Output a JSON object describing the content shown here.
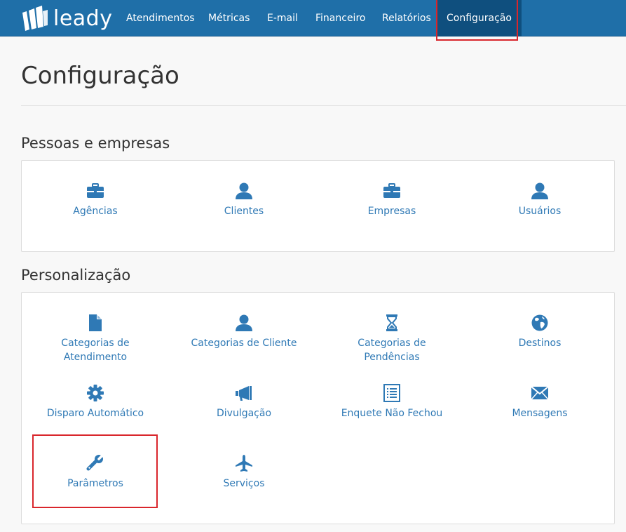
{
  "app": {
    "logo_text": "leady"
  },
  "nav": {
    "items": [
      {
        "label": "Atendimentos"
      },
      {
        "label": "Métricas"
      },
      {
        "label": "E-mail"
      },
      {
        "label": "Financeiro"
      },
      {
        "label": "Relatórios"
      },
      {
        "label": "Configuração",
        "active": true
      }
    ]
  },
  "page": {
    "title": "Configuração"
  },
  "sections": [
    {
      "title": "Pessoas e empresas",
      "items": [
        {
          "label": "Agências",
          "icon": "briefcase-icon"
        },
        {
          "label": "Clientes",
          "icon": "user-icon"
        },
        {
          "label": "Empresas",
          "icon": "briefcase-icon"
        },
        {
          "label": "Usuários",
          "icon": "user-icon"
        }
      ]
    },
    {
      "title": "Personalização",
      "items": [
        {
          "label": "Categorias de Atendimento",
          "icon": "file-icon"
        },
        {
          "label": "Categorias de Cliente",
          "icon": "user-icon"
        },
        {
          "label": "Categorias de Pendências",
          "icon": "hourglass-icon"
        },
        {
          "label": "Destinos",
          "icon": "globe-icon"
        },
        {
          "label": "Disparo Automático",
          "icon": "gear-icon"
        },
        {
          "label": "Divulgação",
          "icon": "megaphone-icon"
        },
        {
          "label": "Enquete Não Fechou",
          "icon": "list-icon"
        },
        {
          "label": "Mensagens",
          "icon": "envelope-icon"
        },
        {
          "label": "Parâmetros",
          "icon": "wrench-icon"
        },
        {
          "label": "Serviços",
          "icon": "plane-icon"
        }
      ]
    }
  ],
  "colors": {
    "navbar": "#1f6fa8",
    "nav_active": "#0f4f7e",
    "link": "#2f79b5",
    "highlight": "#d9262c"
  }
}
